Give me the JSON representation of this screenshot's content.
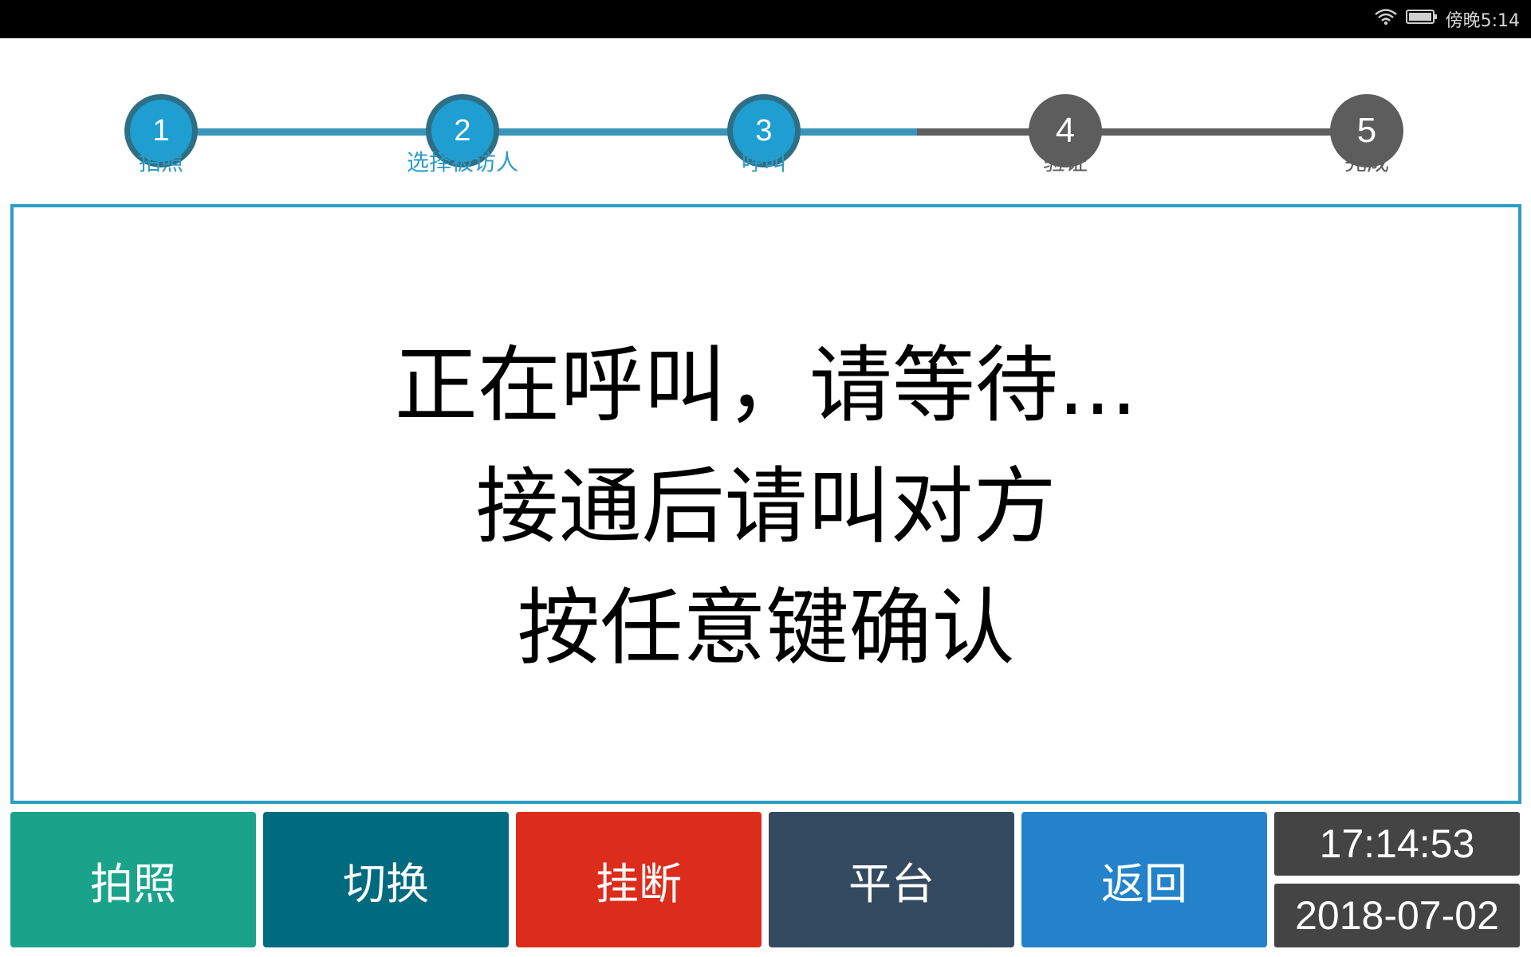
{
  "status_bar": {
    "time_text": "傍晚5:14",
    "icons": [
      "wifi-icon",
      "battery-icon"
    ]
  },
  "stepper": {
    "steps": [
      {
        "number": "1",
        "label": "拍照",
        "state": "done"
      },
      {
        "number": "2",
        "label": "选择被访人",
        "state": "done"
      },
      {
        "number": "3",
        "label": "呼叫",
        "state": "done"
      },
      {
        "number": "4",
        "label": "验证",
        "state": "todo"
      },
      {
        "number": "5",
        "label": "完成",
        "state": "todo"
      }
    ],
    "colors": {
      "active": "#1e9ed1",
      "inactive": "#5d5d5d"
    }
  },
  "message": {
    "line1": "正在呼叫，请等待...",
    "line2": "接通后请叫对方",
    "line3": "按任意键确认"
  },
  "buttons": {
    "photo": {
      "label": "拍照",
      "color": "#1aa38a"
    },
    "switch": {
      "label": "切换",
      "color": "#006a7f"
    },
    "hangup": {
      "label": "挂断",
      "color": "#dc2c1c"
    },
    "platform": {
      "label": "平台",
      "color": "#344a60"
    },
    "back": {
      "label": "返回",
      "color": "#2382c9"
    }
  },
  "clock": {
    "time": "17:14:53",
    "date": "2018-07-02"
  }
}
